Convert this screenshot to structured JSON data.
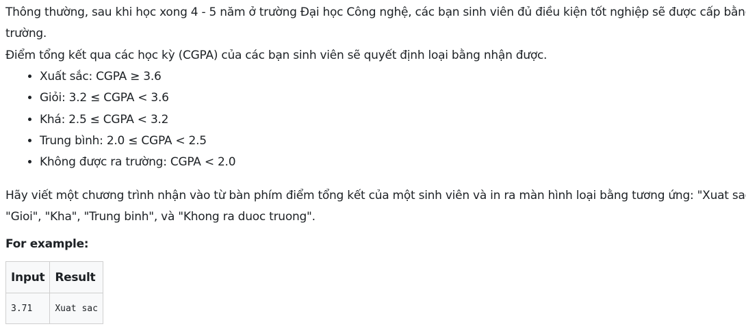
{
  "paragraphs": {
    "intro_line1": "Thông thường, sau khi học xong 4 - 5 năm ở trường Đại học Công nghệ, các bạn sinh viên đủ điều kiện tốt nghiệp sẽ được cấp bằng ra",
    "intro_line2": "trường.",
    "cgpa_intro": "Điểm tổng kết qua các học kỳ (CGPA) của các bạn sinh viên sẽ quyết định loại bằng nhận được.",
    "task_line1": "Hãy viết một chương trình nhận vào từ bàn phím điểm tổng kết của một sinh viên và in ra màn hình loại bằng tương ứng: \"Xuat sac\",",
    "task_line2": "\"Gioi\", \"Kha\", \"Trung binh\", và \"Khong ra duoc truong\"."
  },
  "grades": [
    "Xuất sắc: CGPA ≥ 3.6",
    "Giỏi: 3.2 ≤ CGPA < 3.6",
    "Khá: 2.5 ≤ CGPA < 3.2",
    "Trung bình: 2.0 ≤ CGPA < 2.5",
    "Không được ra trường: CGPA < 2.0"
  ],
  "example": {
    "heading": "For example:",
    "columns": [
      "Input",
      "Result"
    ],
    "rows": [
      [
        "3.71",
        "Xuat sac"
      ]
    ]
  }
}
